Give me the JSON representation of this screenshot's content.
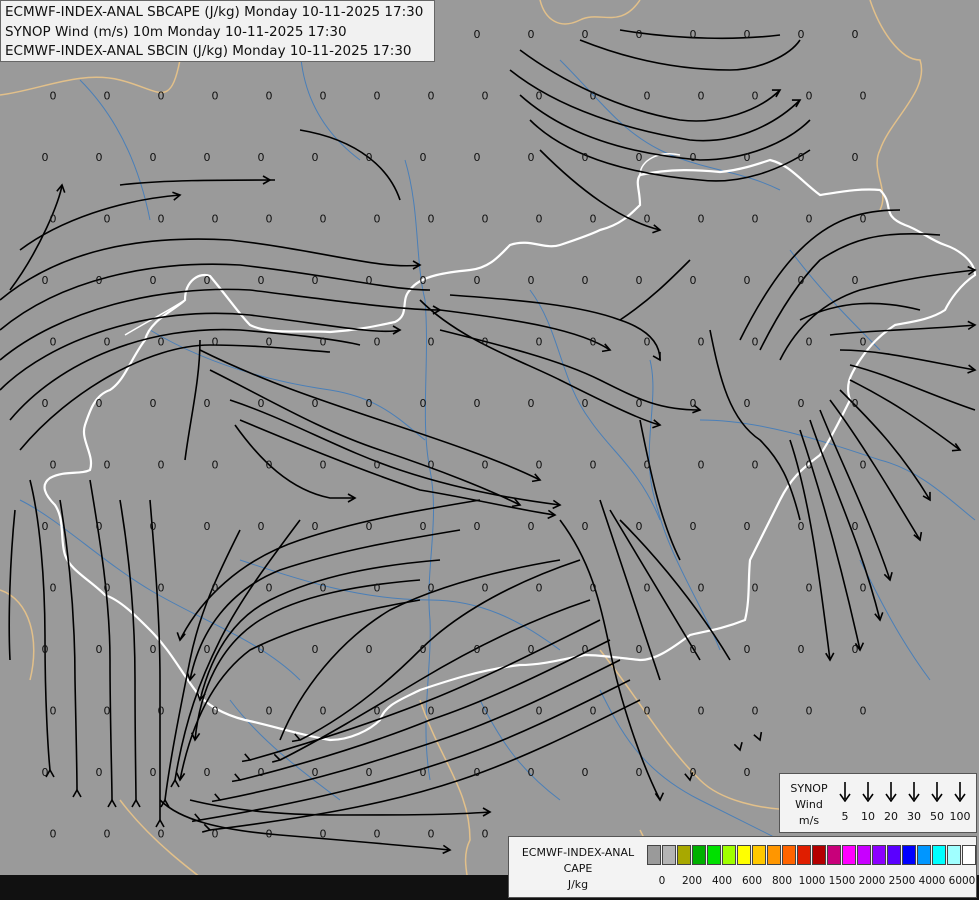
{
  "header": {
    "line1": "ECMWF-INDEX-ANAL SBCAPE (J/kg) Monday 10-11-2025 17:30",
    "line2": "SYNOP Wind (m/s) 10m Monday 10-11-2025 17:30",
    "line3": "ECMWF-INDEX-ANAL SBCIN (J/kg) Monday 10-11-2025 17:30"
  },
  "map": {
    "background_color": "#9a9a9a",
    "border_color": "#ffffff",
    "outer_border_color": "#e2c08a",
    "river_color": "#4a7fb8",
    "streamline_color": "#000000",
    "grid_value": "0"
  },
  "wind_legend": {
    "title_line1": "SYNOP",
    "title_line2": "Wind",
    "title_line3": "m/s",
    "speeds": [
      "5",
      "10",
      "20",
      "30",
      "50",
      "100"
    ]
  },
  "cape_legend": {
    "title_line1": "ECMWF-INDEX-ANAL",
    "title_line2": "CAPE",
    "title_line3": "J/kg",
    "colors": [
      "#9a9a9a",
      "#b4b4b4",
      "#a8a800",
      "#00b000",
      "#00e000",
      "#a0ff00",
      "#ffff00",
      "#ffc800",
      "#ff9600",
      "#ff6400",
      "#e01e00",
      "#b40000",
      "#c8007a",
      "#ff00ff",
      "#c800ff",
      "#8c00ff",
      "#5a00ff",
      "#0000ff",
      "#0096ff",
      "#00ffff",
      "#a0ffff",
      "#ffffff"
    ],
    "ticks": [
      "0",
      "200",
      "400",
      "600",
      "800",
      "1000",
      "1500",
      "2000",
      "2500",
      "4000",
      "6000"
    ]
  }
}
